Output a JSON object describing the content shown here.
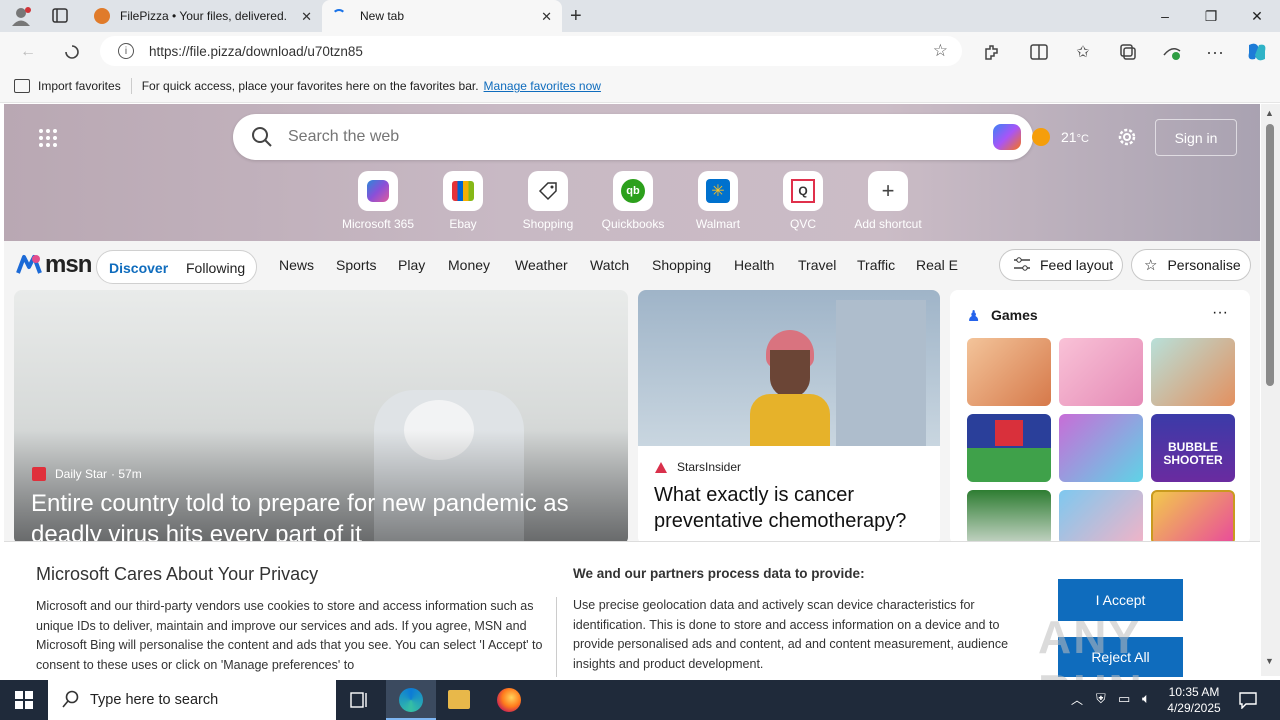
{
  "tabs": [
    {
      "title": "FilePizza • Your files, delivered."
    },
    {
      "title": "New tab"
    }
  ],
  "window_controls": {
    "minimize": "–",
    "maximize": "❐",
    "close": "✕"
  },
  "address": {
    "url": "https://file.pizza/download/u70tzn85"
  },
  "favorites_bar": {
    "import_label": "Import favorites",
    "message": "For quick access, place your favorites here on the favorites bar.",
    "manage_link": "Manage favorites now"
  },
  "search": {
    "placeholder": "Search the web",
    "temperature": "21",
    "temp_unit": "°C",
    "sign_in": "Sign in"
  },
  "shortcuts": [
    {
      "label": "Microsoft 365"
    },
    {
      "label": "Ebay"
    },
    {
      "label": "Shopping"
    },
    {
      "label": "Quickbooks"
    },
    {
      "label": "Walmart"
    },
    {
      "label": "QVC"
    },
    {
      "label": "Add shortcut"
    }
  ],
  "msn": {
    "logo": "msn",
    "tabs": [
      "Discover",
      "Following"
    ],
    "nav": [
      "News",
      "Sports",
      "Play",
      "Money",
      "Weather",
      "Watch",
      "Shopping",
      "Health",
      "Travel",
      "Traffic",
      "Real E"
    ],
    "feed_layout": "Feed layout",
    "personalise": "Personalise"
  },
  "main_story": {
    "source": "Daily Star",
    "time": "· 57m",
    "headline": "Entire country told to prepare for new pandemic as deadly virus hits every part of it"
  },
  "second_story": {
    "source": "StarsInsider",
    "headline": "What exactly is cancer preventative chemotherapy?"
  },
  "games": {
    "title": "Games",
    "more": "···",
    "tiles": [
      "",
      "",
      "",
      "",
      "",
      "",
      "BUBBLE SHOOTER",
      "",
      ""
    ]
  },
  "privacy": {
    "title": "Microsoft Cares About Your Privacy",
    "body": "Microsoft and our third-party vendors use cookies to store and access information such as unique IDs to deliver, maintain and improve our services and ads. If you agree, MSN and Microsoft Bing will personalise the content and ads that you see. You can select 'I Accept' to consent to these uses or click on 'Manage preferences' to",
    "partners_title": "We and our partners process data to provide:",
    "partners_body": "Use precise geolocation data and actively scan device characteristics for identification. This is done to store and access information on a device and to provide personalised ads and content, ad and content measurement, audience insights and product development.",
    "accept": "I Accept",
    "reject": "Reject All"
  },
  "taskbar": {
    "search_placeholder": "Type here to search",
    "time": "10:35 AM",
    "date": "4/29/2025"
  },
  "watermark": "ANY RUN"
}
